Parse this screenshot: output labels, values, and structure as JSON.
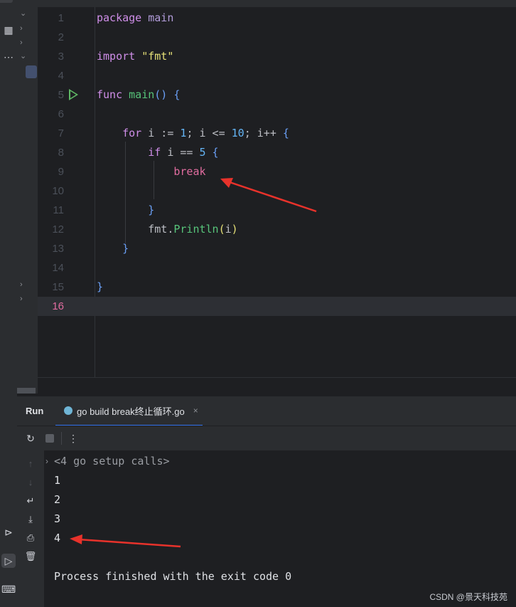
{
  "editor": {
    "lines": [
      {
        "n": "1",
        "tokens": [
          [
            "kw",
            "package"
          ],
          [
            "",
            ""
          ],
          [
            "pk",
            " main"
          ]
        ]
      },
      {
        "n": "2",
        "tokens": []
      },
      {
        "n": "3",
        "tokens": [
          [
            "kw",
            "import"
          ],
          [
            "str",
            " \"fmt\""
          ]
        ]
      },
      {
        "n": "4",
        "tokens": []
      },
      {
        "n": "5",
        "tokens": [
          [
            "kw",
            "func"
          ],
          [
            "fn",
            " main"
          ],
          [
            "br",
            "()"
          ],
          [
            "",
            ""
          ],
          [
            "br",
            " {"
          ]
        ]
      },
      {
        "n": "6",
        "tokens": []
      },
      {
        "n": "7",
        "tokens": [
          [
            "",
            "    "
          ],
          [
            "kw",
            "for"
          ],
          [
            "",
            " i := "
          ],
          [
            "num",
            "1"
          ],
          [
            "",
            "; i <= "
          ],
          [
            "num",
            "10"
          ],
          [
            "",
            "; i++ "
          ],
          [
            "br",
            "{"
          ]
        ]
      },
      {
        "n": "8",
        "tokens": [
          [
            "",
            "        "
          ],
          [
            "kw",
            "if"
          ],
          [
            "",
            " i == "
          ],
          [
            "num",
            "5"
          ],
          [
            "",
            ""
          ],
          [
            "br",
            " {"
          ]
        ]
      },
      {
        "n": "9",
        "tokens": [
          [
            "",
            "            "
          ],
          [
            "kw2",
            "break"
          ]
        ]
      },
      {
        "n": "10",
        "tokens": []
      },
      {
        "n": "11",
        "tokens": [
          [
            "",
            "        "
          ],
          [
            "br",
            "}"
          ]
        ]
      },
      {
        "n": "12",
        "tokens": [
          [
            "",
            "        fmt."
          ],
          [
            "fn",
            "Println"
          ],
          [
            "str",
            "("
          ],
          [
            "",
            "i"
          ],
          [
            "str",
            ")"
          ]
        ]
      },
      {
        "n": "13",
        "tokens": [
          [
            "",
            "    "
          ],
          [
            "br",
            "}"
          ]
        ]
      },
      {
        "n": "14",
        "tokens": []
      },
      {
        "n": "15",
        "tokens": [
          [
            "br",
            "}"
          ]
        ]
      },
      {
        "n": "16",
        "tokens": []
      }
    ],
    "current_line": "16"
  },
  "run": {
    "title": "Run",
    "tab_label": "go build break终止循环.go",
    "close_glyph": "×",
    "console": {
      "collapsed": "<4 go setup calls>",
      "outputs": [
        "1",
        "2",
        "3",
        "4"
      ],
      "finish": "Process finished with the exit code 0"
    }
  },
  "watermark": "CSDN @景天科技苑",
  "colors": {
    "accent": "#3574f0",
    "arrow": "#e8322b",
    "run_gutter": "#5fb865"
  }
}
